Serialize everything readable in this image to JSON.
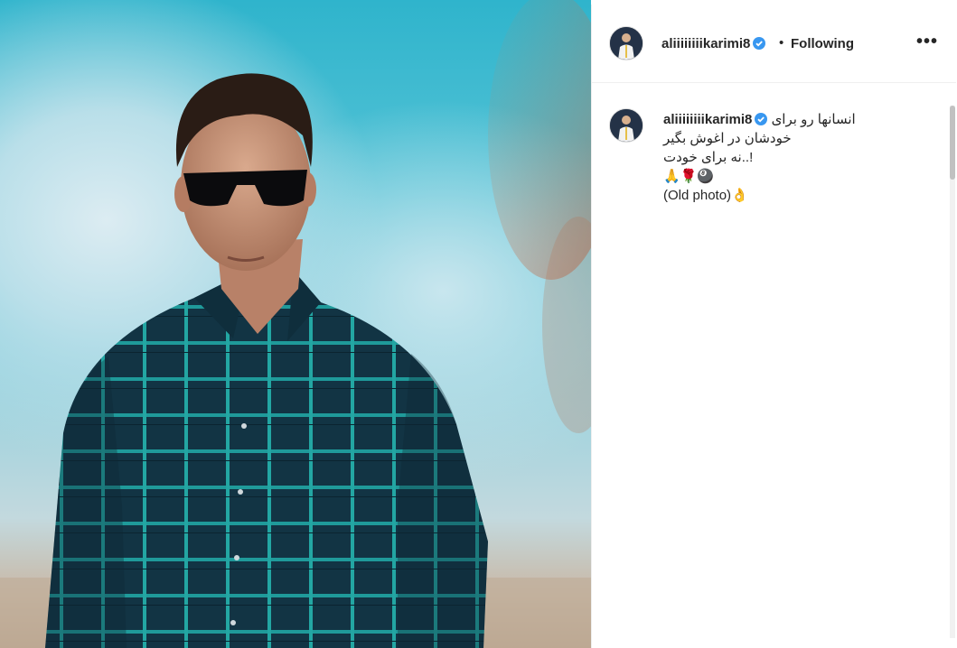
{
  "post": {
    "username": "aliiiiiiiikarimi8",
    "follow_status": "Following",
    "dot": "•",
    "more": "•••",
    "caption_lines": [
      "انسانها رو برای",
      "خودشان در اغوش بگیر",
      "!..نه برای خودت",
      "🙏🌹🎱",
      "(Old photo)👌"
    ]
  },
  "icons": {
    "verified": "verified-badge-icon",
    "more": "more-options-icon"
  },
  "colors": {
    "verified": "#3897f0",
    "text": "#262626",
    "border": "#efefef"
  }
}
